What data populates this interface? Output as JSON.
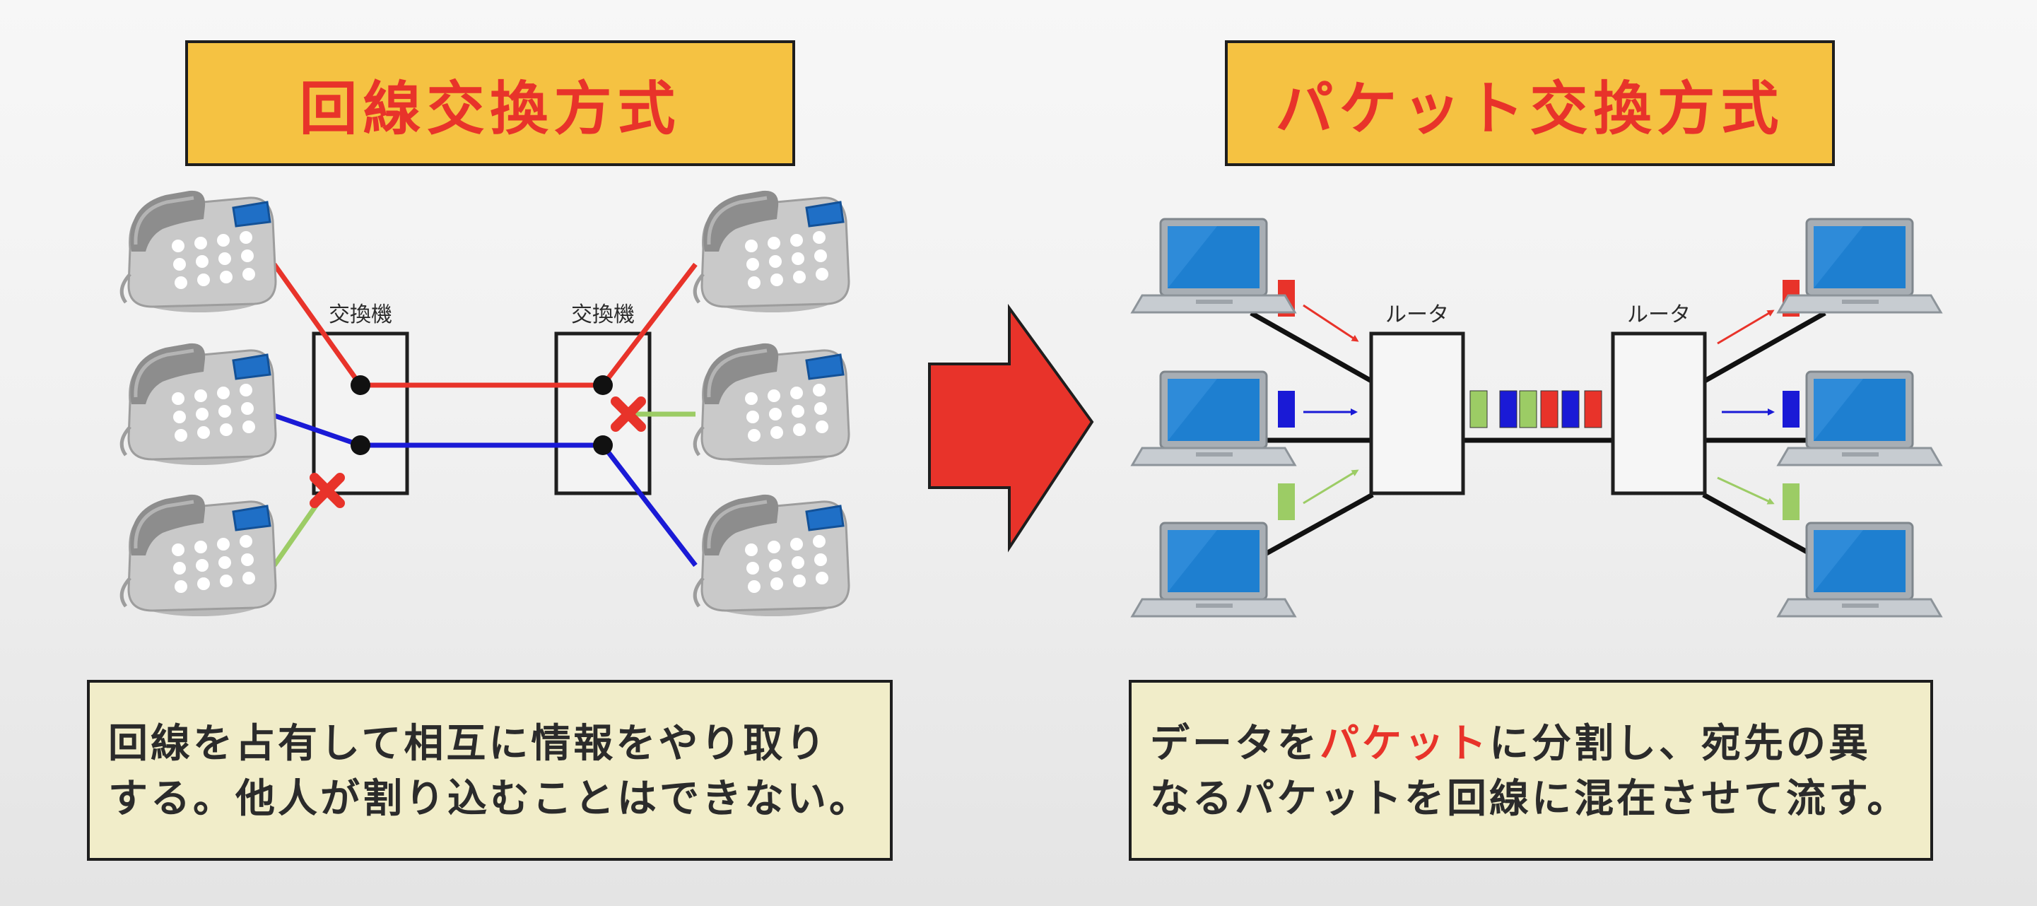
{
  "left": {
    "title": "回線交換方式",
    "switch_label_1": "交換機",
    "switch_label_2": "交換機",
    "description_line1": "回線を占有して相互に情報をやり取り",
    "description_line2": "する。他人が割り込むことはできない。"
  },
  "right": {
    "title": "パケット交換方式",
    "router_label_1": "ルータ",
    "router_label_2": "ルータ",
    "description_line1_pre": "データを",
    "description_line1_highlight": "パケット",
    "description_line1_post": "に分割し、宛先の異",
    "description_line2": "なるパケットを回線に混在させて流す。"
  },
  "colors": {
    "accent_red": "#e8332a",
    "title_bg": "#f5c242",
    "desc_bg": "#f1edc9",
    "line_blue": "#1a1ad6",
    "line_green": "#9ccc65"
  },
  "icons": {
    "telephone": "telephone-icon",
    "laptop": "laptop-icon",
    "blocked": "x-mark-icon",
    "arrow": "right-arrow-icon"
  }
}
